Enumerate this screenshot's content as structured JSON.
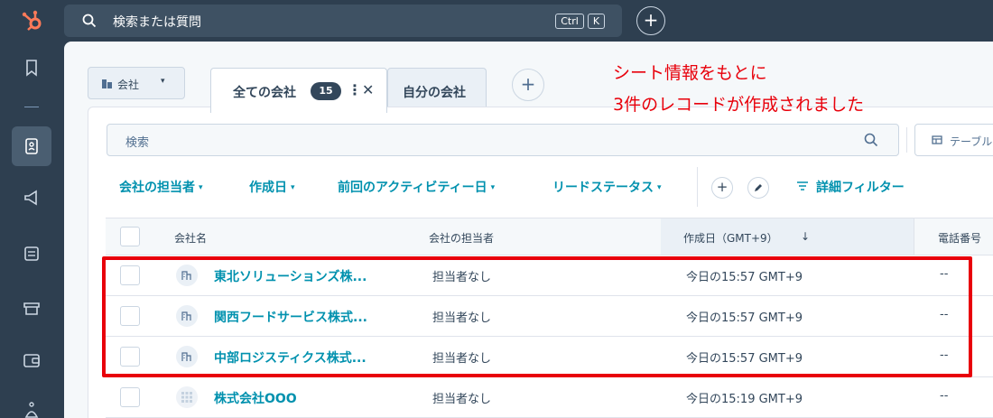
{
  "topbar": {
    "search_placeholder": "検索または質問",
    "shortcut_ctrl": "Ctrl",
    "shortcut_key": "K",
    "add_label": "+"
  },
  "object_selector": {
    "label": "会社",
    "caret": "▾"
  },
  "tabs": [
    {
      "label": "全ての会社",
      "count": "15",
      "more": "⋮",
      "close": "✕"
    },
    {
      "label": "自分の会社"
    }
  ],
  "add_tab_label": "+",
  "search": {
    "placeholder": "検索",
    "table_label": "テーブル"
  },
  "filters": [
    {
      "label": "会社の担当者"
    },
    {
      "label": "作成日"
    },
    {
      "label": "前回のアクティビティー日"
    },
    {
      "label": "リードステータス"
    }
  ],
  "filter_caret": "▾",
  "filter_add": "+",
  "advanced_filter": "詳細フィルター",
  "table": {
    "columns": [
      "会社名",
      "会社の担当者",
      "作成日（GMT+9）",
      "電話番号"
    ],
    "sort_arrow": "↓",
    "rows": [
      {
        "name": "東北ソリューションズ株...",
        "owner": "担当者なし",
        "created": "今日の15:57 GMT+9",
        "phone": "--"
      },
      {
        "name": "関西フードサービス株式...",
        "owner": "担当者なし",
        "created": "今日の15:57 GMT+9",
        "phone": "--"
      },
      {
        "name": "中部ロジスティクス株式...",
        "owner": "担当者なし",
        "created": "今日の15:57 GMT+9",
        "phone": "--"
      },
      {
        "name": "株式会社OOO",
        "owner": "担当者なし",
        "created": "今日の15:19 GMT+9",
        "phone": "--"
      }
    ]
  },
  "annotation": {
    "line1": "シート情報をもとに",
    "line2": "3件のレコードが作成されました",
    "color": "#e8000b"
  },
  "colors": {
    "nav_bg": "#2e3f50",
    "link": "#0091ae",
    "accent": "#ff7a59"
  }
}
